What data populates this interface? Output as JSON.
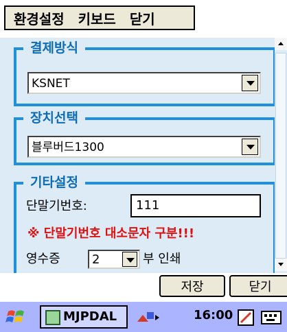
{
  "menu": {
    "items": [
      "환경설정",
      "키보드",
      "닫기"
    ]
  },
  "payment_group": {
    "title": "결제방식",
    "selected": "KSNET"
  },
  "device_group": {
    "title": "장치선택",
    "selected": "블루버드1300"
  },
  "other_group": {
    "title": "기타설정",
    "terminal_id_label": "단말기번호:",
    "terminal_id_value": "111",
    "warning": "※ 단말기번호 대소문자 구분!!!",
    "receipt_label": "영수증",
    "receipt_count": "2",
    "receipt_suffix": "부 인쇄"
  },
  "buttons": {
    "save": "저장",
    "close": "닫기"
  },
  "taskbar": {
    "app_label": "MJPDAL",
    "clock": "16:00",
    "start_icon": "windows-flag-icon",
    "tray_icons": [
      "network-icon",
      "sync-icon",
      "pen-input-icon",
      "keyboard-icon"
    ]
  },
  "colors": {
    "group_border": "#1f90e0",
    "group_title": "#0e6bb5",
    "warning": "#e01010",
    "client_bg": "#dcebf6",
    "taskbar_bg": "#aab4ff"
  }
}
